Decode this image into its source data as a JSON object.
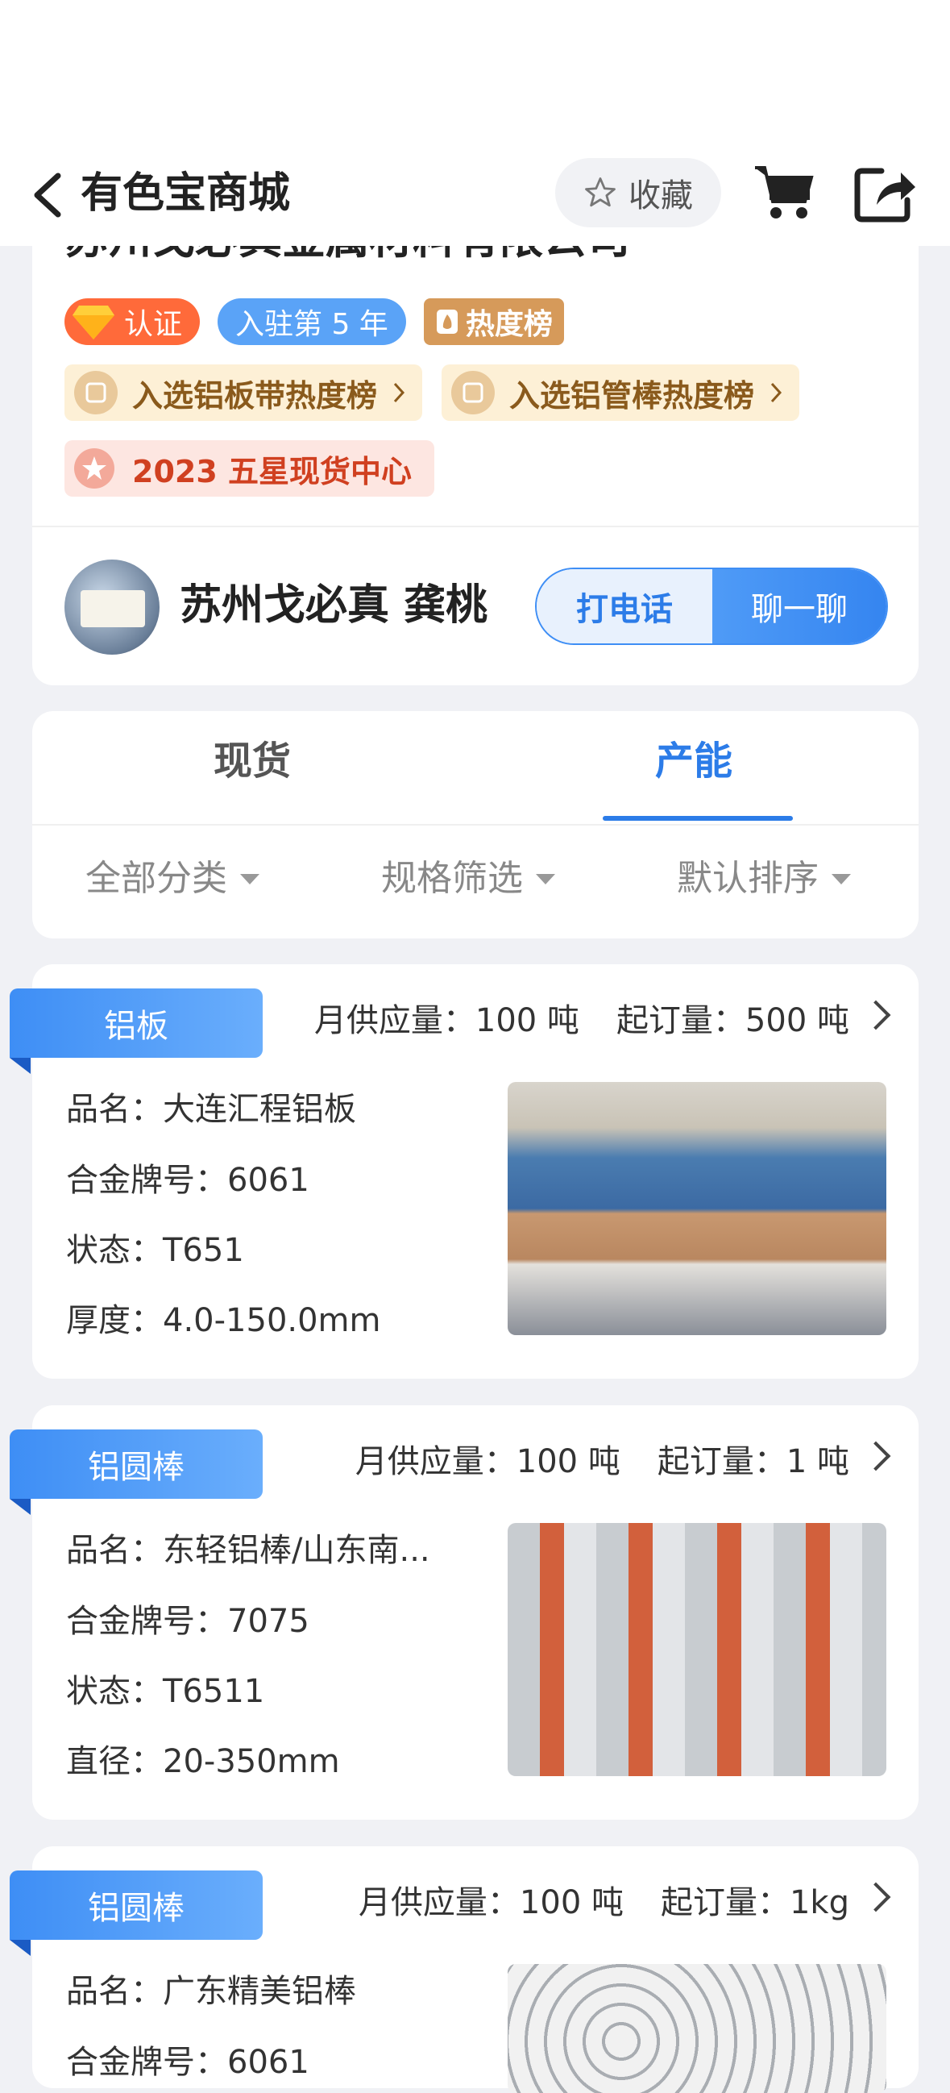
{
  "header": {
    "title": "有色宝商城",
    "favorite_label": "收藏"
  },
  "store": {
    "name": "苏州戈必真金属材料有限公司",
    "badges": {
      "certified": "认证",
      "years": "入驻第 5 年",
      "hot": "热度榜"
    },
    "rankings": [
      "入选铝板带热度榜",
      "入选铝管棒热度榜"
    ],
    "star_center": "2023 五星现货中心",
    "seller": "苏州戈必真 龚桃",
    "call_label": "打电话",
    "chat_label": "聊一聊"
  },
  "tabs": {
    "spot": "现货",
    "capacity": "产能"
  },
  "filters": {
    "category": "全部分类",
    "spec": "规格筛选",
    "sort": "默认排序"
  },
  "products": [
    {
      "category": "铝板",
      "supply": "月供应量：100 吨",
      "min_order": "起订量：500 吨",
      "attrs": [
        "品名：大连汇程铝板",
        "合金牌号：6061",
        "状态：T651",
        "厚度：4.0-150.0mm"
      ]
    },
    {
      "category": "铝圆棒",
      "supply": "月供应量：100 吨",
      "min_order": "起订量：1 吨",
      "attrs": [
        "品名：东轻铝棒/山东南...",
        "合金牌号：7075",
        "状态：T6511",
        "直径：20-350mm"
      ]
    },
    {
      "category": "铝圆棒",
      "supply": "月供应量：100 吨",
      "min_order": "起订量：1kg",
      "attrs": [
        "品名：广东精美铝棒",
        "合金牌号：6061"
      ]
    }
  ],
  "colors": {
    "accent": "#2c7ce8",
    "background": "#f0f1f5"
  }
}
